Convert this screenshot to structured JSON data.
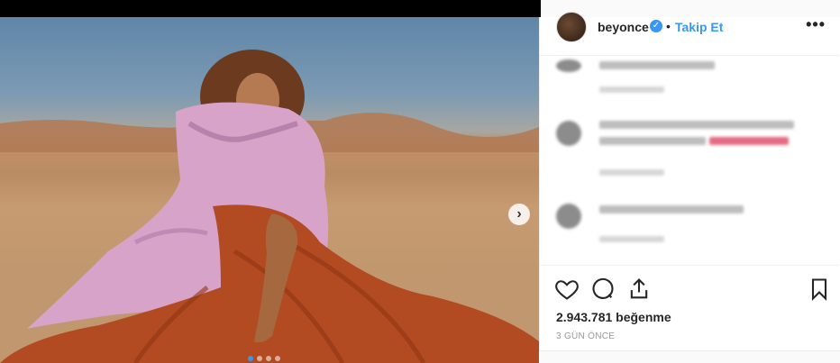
{
  "post": {
    "username": "beyonce",
    "separator": "•",
    "follow_label": "Takip Et",
    "more_label": "•••",
    "verified_icon": "check-verified-icon",
    "likes": "2.943.781 beğenme",
    "time": "3 GÜN ÖNCE"
  },
  "media": {
    "next_label": "›",
    "carousel_count": 4,
    "active_index": 0
  },
  "colors": {
    "accent": "#3897f0"
  }
}
